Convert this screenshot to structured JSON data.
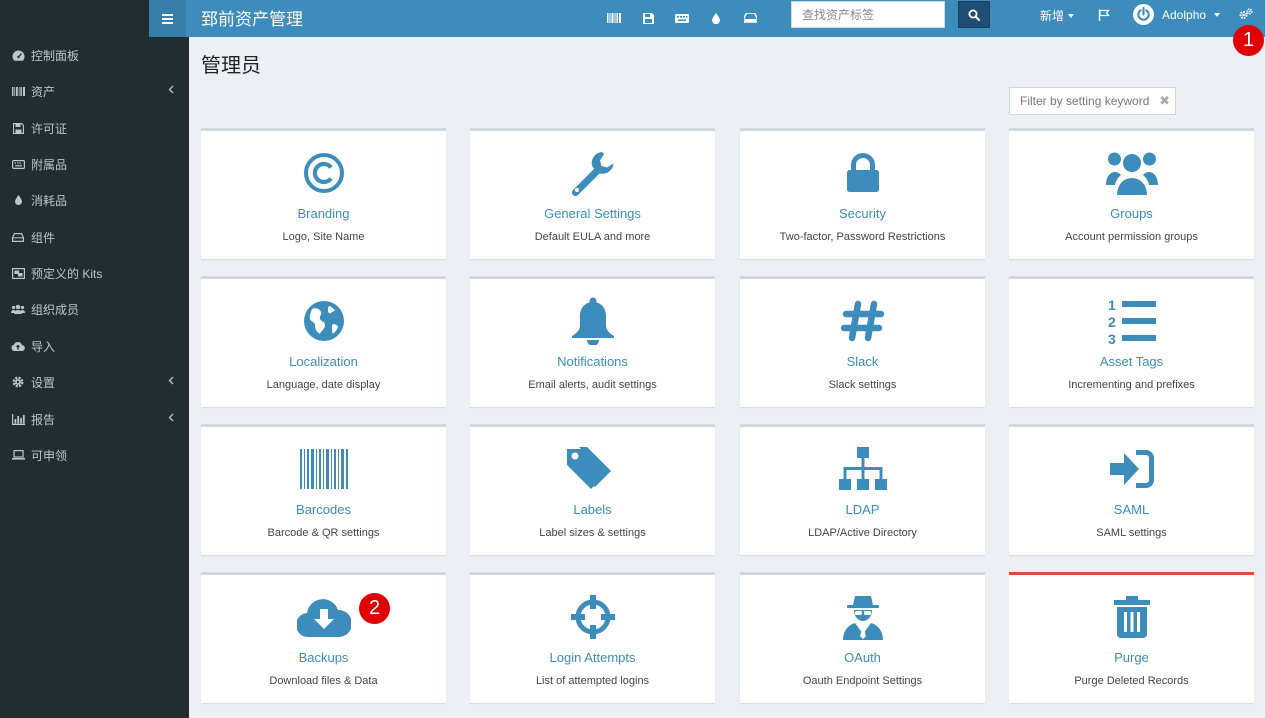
{
  "app": {
    "title": "郅前资产管理"
  },
  "search": {
    "placeholder": "查找资产标签"
  },
  "header": {
    "new_label": "新增",
    "user_name": "Adolpho"
  },
  "badges": {
    "one": "1",
    "two": "2"
  },
  "colors": {
    "topbar": "#3c8dbc",
    "sidebar": "#222d32",
    "icon": "#3c8dbc",
    "badge": "#e00000",
    "danger_border": "#dd4b39"
  },
  "sidebar": {
    "items": [
      {
        "label": "控制面板",
        "icon": "dashboard-icon"
      },
      {
        "label": "资产",
        "icon": "barcode-icon"
      },
      {
        "label": "许可证",
        "icon": "save-icon"
      },
      {
        "label": "附属品",
        "icon": "keyboard-icon"
      },
      {
        "label": "消耗品",
        "icon": "tint-icon"
      },
      {
        "label": "组件",
        "icon": "hdd-icon"
      },
      {
        "label": "预定义的 Kits",
        "icon": "object-group-icon"
      },
      {
        "label": "组织成员",
        "icon": "users-icon"
      },
      {
        "label": "导入",
        "icon": "cloud-upload-icon"
      },
      {
        "label": "设置",
        "icon": "cog-icon"
      },
      {
        "label": "报告",
        "icon": "bar-chart-icon"
      },
      {
        "label": "可申领",
        "icon": "laptop-icon"
      }
    ]
  },
  "main": {
    "title": "管理员",
    "filter_placeholder": "Filter by setting keyword",
    "clear_symbol": "✖",
    "cards": [
      {
        "title": "Branding",
        "desc": "Logo, Site Name",
        "icon": "copyright-icon"
      },
      {
        "title": "General Settings",
        "desc": "Default EULA and more",
        "icon": "wrench-icon"
      },
      {
        "title": "Security",
        "desc": "Two-factor, Password Restrictions",
        "icon": "lock-icon"
      },
      {
        "title": "Groups",
        "desc": "Account permission groups",
        "icon": "users-icon"
      },
      {
        "title": "Localization",
        "desc": "Language, date display",
        "icon": "globe-icon"
      },
      {
        "title": "Notifications",
        "desc": "Email alerts, audit settings",
        "icon": "bell-icon"
      },
      {
        "title": "Slack",
        "desc": "Slack settings",
        "icon": "hashtag-icon"
      },
      {
        "title": "Asset Tags",
        "desc": "Incrementing and prefixes",
        "icon": "list-ol-icon"
      },
      {
        "title": "Barcodes",
        "desc": "Barcode & QR settings",
        "icon": "barcode-icon"
      },
      {
        "title": "Labels",
        "desc": "Label sizes & settings",
        "icon": "tags-icon"
      },
      {
        "title": "LDAP",
        "desc": "LDAP/Active Directory",
        "icon": "sitemap-icon"
      },
      {
        "title": "SAML",
        "desc": "SAML settings",
        "icon": "sign-in-icon"
      },
      {
        "title": "Backups",
        "desc": "Download files & Data",
        "icon": "cloud-download-icon"
      },
      {
        "title": "Login Attempts",
        "desc": "List of attempted logins",
        "icon": "crosshairs-icon"
      },
      {
        "title": "OAuth",
        "desc": "Oauth Endpoint Settings",
        "icon": "user-secret-icon"
      },
      {
        "title": "Purge",
        "desc": "Purge Deleted Records",
        "icon": "trash-icon"
      }
    ]
  }
}
